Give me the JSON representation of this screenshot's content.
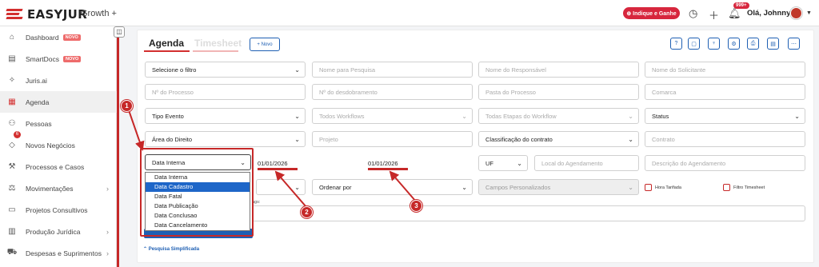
{
  "header": {
    "brand": "EASYJUR",
    "plan": "Growth +",
    "indique_label": "⊕ Indique e Ganhe",
    "notif_badge": "999+",
    "greeting": "Olá, Johnny",
    "brand_color": "#d32f2f"
  },
  "sidebar": {
    "items": [
      {
        "label": "Dashboard",
        "icon": "home-icon",
        "badge": "NOVO"
      },
      {
        "label": "SmartDocs",
        "icon": "document-icon",
        "badge": "NOVO"
      },
      {
        "label": "Juris.ai",
        "icon": "ai-icon"
      },
      {
        "label": "Agenda",
        "icon": "calendar-icon"
      },
      {
        "label": "Pessoas",
        "icon": "people-icon"
      },
      {
        "label": "Novos Negócios",
        "icon": "handshake-icon"
      },
      {
        "label": "Processos e Casos",
        "icon": "gavel-icon"
      },
      {
        "label": "Movimentações",
        "icon": "scale-icon"
      },
      {
        "label": "Projetos Consultivos",
        "icon": "briefcase-icon"
      },
      {
        "label": "Produção Jurídica",
        "icon": "file-icon"
      },
      {
        "label": "Despesas e Suprimentos",
        "icon": "cart-icon"
      }
    ],
    "agenda_badge": "6"
  },
  "tabs": {
    "agenda": "Agenda",
    "timesheet": "Timesheet",
    "novo": "+ Novo"
  },
  "filters": {
    "select_filter": "Selecione o filtro",
    "nome_pesquisa": "Nome para Pesquisa",
    "nome_responsavel": "Nome do Responsável",
    "nome_solicitante": "Nome do Solicitante",
    "num_processo": "Nº do Processo",
    "num_desdobramento": "Nº do desdobramento",
    "pasta_processo": "Pasta do Processo",
    "comarca": "Comarca",
    "tipo_evento": "Tipo Evento",
    "todos_workflows": "Todos Workflows",
    "todas_etapas": "Todas Etapas do Workflow",
    "status": "Status",
    "area_direito": "Área do Direito",
    "projeto": "Projeto",
    "classificacao_contrato": "Classificação do contrato",
    "contrato": "Contrato",
    "date_type_selected": "Data Interna",
    "date_start": "01/01/2026",
    "date_end": "01/01/2026",
    "uf": "UF",
    "local_agendamento": "Local do Agendamento",
    "descricao_agendamento": "Descrição do Agendamento",
    "ordenar_por": "Ordenar por",
    "campos_personalizados": "Campos Personalizados",
    "hora_tarifada": "Hora Tarifada",
    "filtro_timesheet": "Filtro Timesheet",
    "tags_label": "ags:",
    "pesquisa_simplificada": "⌃ Pesquisa Simplificada"
  },
  "date_options": [
    "Data Interna",
    "Data Cadastro",
    "Data Fatal",
    "Data Publicação",
    "Data Conclusao",
    "Data Cancelamento"
  ],
  "selected_option_index": 1,
  "callouts": [
    "1",
    "2",
    "3"
  ],
  "annotation_color": "#c62828"
}
